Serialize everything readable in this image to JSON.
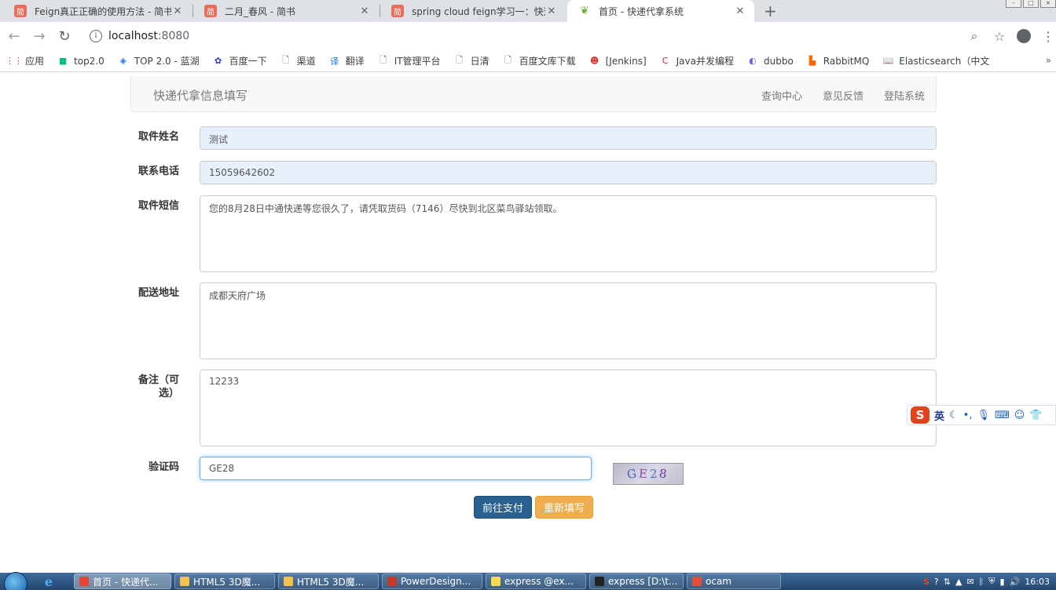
{
  "browser": {
    "tabs": [
      {
        "title": "Feign真正正确的使用方法 - 简书",
        "favicon": "简",
        "close": "✕"
      },
      {
        "title": "二月_春风 - 简书",
        "favicon": "简",
        "close": "✕"
      },
      {
        "title": "spring cloud feign学习一：快速",
        "favicon": "简",
        "close": "✕"
      },
      {
        "title": "首页 - 快递代拿系统",
        "favicon": "leaf-icon",
        "close": "✕"
      }
    ],
    "new_tab": "+",
    "url_host": "localhost",
    "url_port": ":8080",
    "bookmarks": [
      {
        "label": "应用",
        "icon": "apps-grid-icon",
        "color": "#d93025"
      },
      {
        "label": "top2.0",
        "icon": "square-icon",
        "color": "#0fb886"
      },
      {
        "label": "TOP 2.0 - 蓝湖",
        "icon": "lanhu-icon",
        "color": "#1677ff"
      },
      {
        "label": "百度一下",
        "icon": "baidu-paw-icon",
        "color": "#2932e1"
      },
      {
        "label": "渠道",
        "icon": "page-icon",
        "color": "#5f6368"
      },
      {
        "label": "翻译",
        "icon": "translate-icon",
        "color": "#1a73e8"
      },
      {
        "label": "IT管理平台",
        "icon": "page-icon",
        "color": "#5f6368"
      },
      {
        "label": "日清",
        "icon": "page-icon",
        "color": "#5f6368"
      },
      {
        "label": "百度文库下载",
        "icon": "page-icon",
        "color": "#5f6368"
      },
      {
        "label": "[Jenkins]",
        "icon": "jenkins-icon",
        "color": "#d33833"
      },
      {
        "label": "Java并发编程",
        "icon": "csdn-icon",
        "color": "#c32136"
      },
      {
        "label": "dubbo",
        "icon": "dubbo-icon",
        "color": "#7b5cd6"
      },
      {
        "label": "RabbitMQ",
        "icon": "rabbit-icon",
        "color": "#ff6600"
      },
      {
        "label": "Elasticsearch（中文",
        "icon": "book-icon",
        "color": "#3c4043"
      }
    ],
    "bookmarks_more": "»"
  },
  "site": {
    "brand": "快递代拿信息填写",
    "nav": [
      "查询中心",
      "意见反馈",
      "登陆系统"
    ]
  },
  "form": {
    "name": {
      "label": "取件姓名",
      "value": "测试"
    },
    "phone": {
      "label": "联系电话",
      "value": "15059642602"
    },
    "sms": {
      "label": "取件短信",
      "value": "您的8月28日中通快递等您很久了，请凭取货码（7146）尽快到北区菜鸟驿站领取。"
    },
    "address": {
      "label": "配送地址",
      "value": "成都天府广场"
    },
    "remark": {
      "label": "备注（可选）",
      "value": "12233"
    },
    "captcha": {
      "label": "验证码",
      "value": "GE28",
      "image_chars": [
        "G",
        "E",
        "2",
        "8"
      ]
    },
    "submit_label": "前往支付",
    "reset_label": "重新填写"
  },
  "ime": {
    "lang": "英"
  },
  "taskbar": {
    "items": [
      {
        "label": "首页 - 快递代...",
        "active": true,
        "color": "#ea4335"
      },
      {
        "label": "HTML5 3D魔...",
        "active": false,
        "color": "#f2c14e"
      },
      {
        "label": "HTML5 3D魔...",
        "active": false,
        "color": "#f2c14e"
      },
      {
        "label": "PowerDesign...",
        "active": false,
        "color": "#c0392b"
      },
      {
        "label": "express @ex...",
        "active": false,
        "color": "#f7d94c"
      },
      {
        "label": "express [D:\\t...",
        "active": false,
        "color": "#222222"
      },
      {
        "label": "ocam",
        "active": false,
        "color": "#e74c3c"
      }
    ],
    "clock": "16:03"
  }
}
